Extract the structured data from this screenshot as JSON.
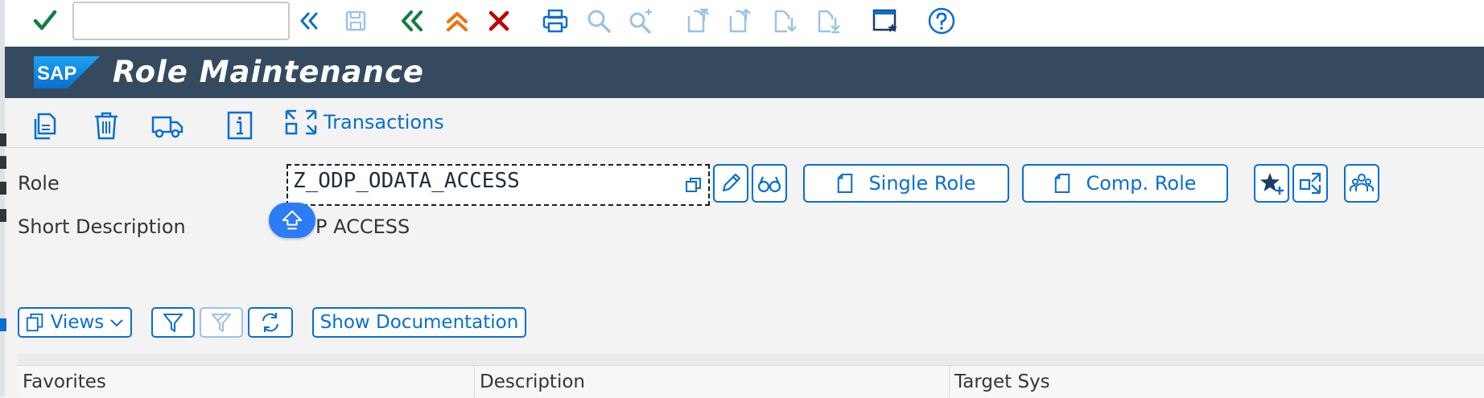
{
  "toolbar": {
    "okcode_value": "",
    "icons": [
      "check-icon",
      "collapse-double-left-icon",
      "save-icon",
      "back-icon",
      "exit-icon",
      "cancel-icon",
      "print-icon",
      "find-icon",
      "find-next-icon",
      "first-page-icon",
      "previous-page-icon",
      "next-page-icon",
      "last-page-icon",
      "customize-layout-icon",
      "help-icon"
    ]
  },
  "header": {
    "logo": "SAP",
    "title": "Role Maintenance"
  },
  "app_toolbar": {
    "transactions_label": "Transactions"
  },
  "form": {
    "role_label": "Role",
    "role_value": "Z_ODP_ODATA_ACCESS",
    "short_desc_label": "Short Description",
    "short_desc_value": "P ACCESS",
    "single_role_label": "Single Role",
    "comp_role_label": "Comp. Role"
  },
  "list_toolbar": {
    "views_label": "Views",
    "show_doc_label": "Show Documentation",
    "more_indicator": "....."
  },
  "table": {
    "columns": [
      "Favorites",
      "Description",
      "Target Sys"
    ]
  },
  "colors": {
    "accent": "#0a6ed1",
    "title_bar": "#354a5f",
    "ok_green": "#107e3e",
    "cancel_red": "#bb0000",
    "up_orange": "#e9730c"
  }
}
